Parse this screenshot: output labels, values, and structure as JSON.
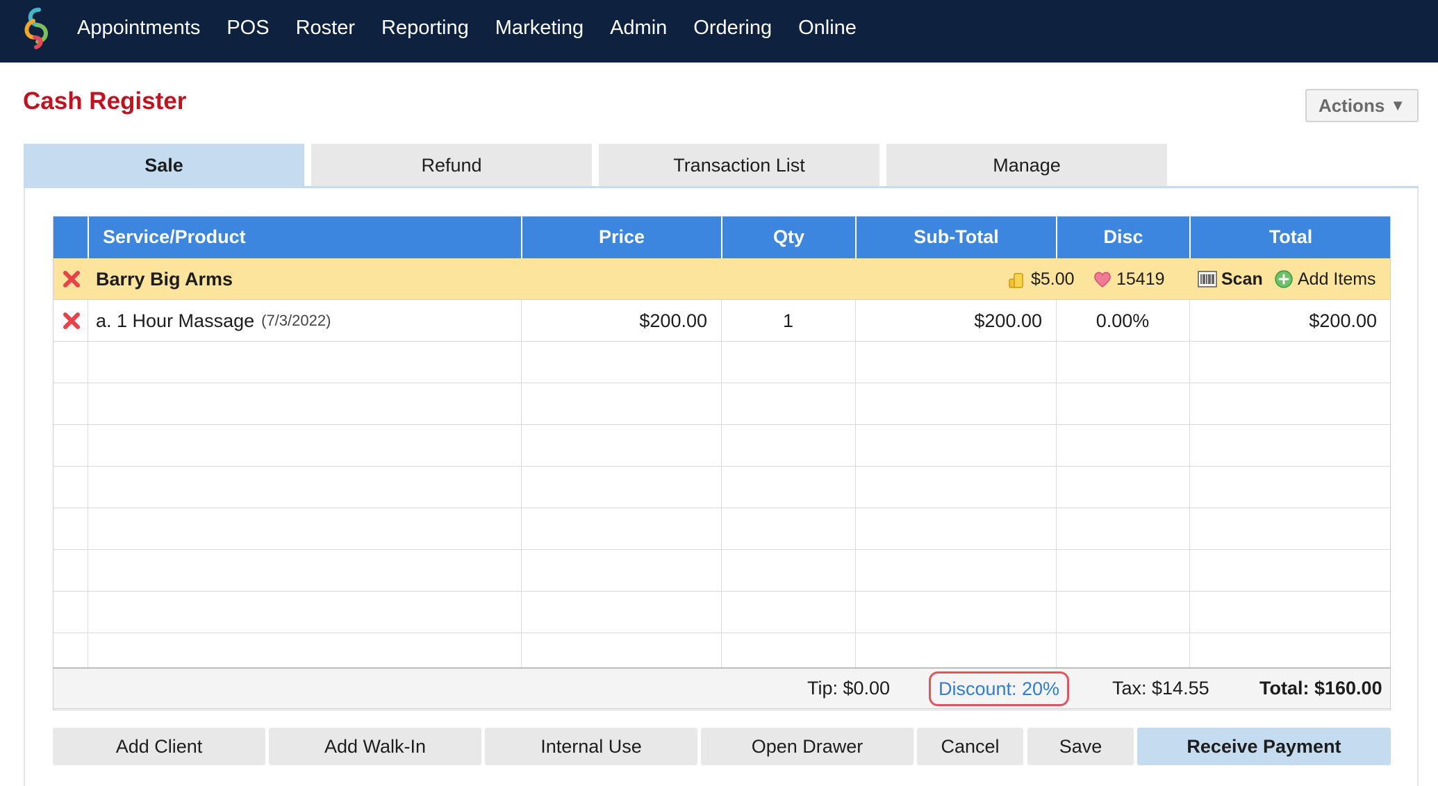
{
  "nav": {
    "items": [
      "Appointments",
      "POS",
      "Roster",
      "Reporting",
      "Marketing",
      "Admin",
      "Ordering",
      "Online"
    ]
  },
  "page": {
    "title": "Cash Register",
    "actions_label": "Actions",
    "actions_caret": "▼"
  },
  "tabs": [
    {
      "label": "Sale",
      "active": true
    },
    {
      "label": "Refund",
      "active": false
    },
    {
      "label": "Transaction List",
      "active": false
    },
    {
      "label": "Manage",
      "active": false
    }
  ],
  "table": {
    "columns": [
      "Service/Product",
      "Price",
      "Qty",
      "Sub-Total",
      "Disc",
      "Total"
    ],
    "client": {
      "name": "Barry Big Arms",
      "balance": "$5.00",
      "loyalty_points": "15419",
      "scan_label": "Scan",
      "add_items_label": "Add Items"
    },
    "items": [
      {
        "name": "a. 1 Hour Massage",
        "date": "(7/3/2022)",
        "price": "$200.00",
        "qty": "1",
        "subtotal": "$200.00",
        "disc": "0.00%",
        "total": "$200.00"
      }
    ]
  },
  "totals": {
    "tip": "Tip: $0.00",
    "discount": "Discount: 20%",
    "tax": "Tax: $14.55",
    "total": "Total: $160.00"
  },
  "buttons": {
    "add_client": "Add Client",
    "add_walkin": "Add Walk-In",
    "internal_use": "Internal Use",
    "open_drawer": "Open Drawer",
    "cancel": "Cancel",
    "save": "Save",
    "receive_payment": "Receive Payment"
  },
  "colors": {
    "nav_bg": "#0e2240",
    "title_red": "#c2121f",
    "header_blue": "#3d86e0",
    "client_row_yellow": "#fde49d",
    "active_tab": "#c5dcf0",
    "discount_highlight": "#e2535f"
  },
  "icons": {
    "logo": "logo-icon",
    "delete": "x-icon",
    "balance": "coins-icon",
    "loyalty": "heart-icon",
    "scan": "barcode-icon",
    "add": "plus-circle-icon"
  }
}
